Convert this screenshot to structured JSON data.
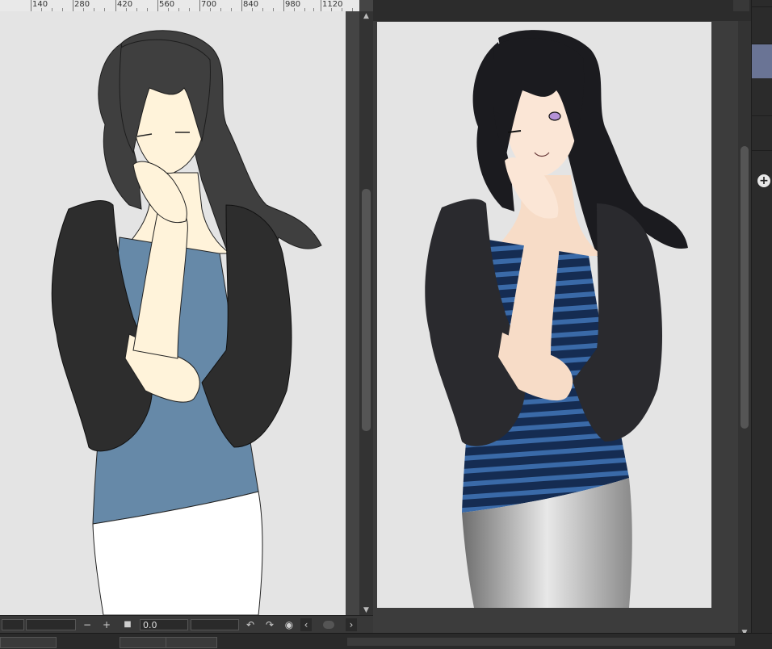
{
  "ruler": {
    "labels": [
      "140",
      "280",
      "420",
      "560",
      "700",
      "840",
      "980",
      "1120"
    ]
  },
  "left_canvas": {
    "angle_value": "0.0",
    "zoom_out_label": "−",
    "zoom_in_label": "+",
    "fit_label": "■",
    "prev_label": "‹",
    "next_label": "›"
  },
  "right_panel": {
    "add_label": "+"
  },
  "colors": {
    "hair": "#3f3f3f",
    "skin": "#fff3da",
    "top_flat": "#6689a8",
    "jacket": "#2d2d2d",
    "pants_flat": "#ffffff",
    "top_rendered": "#1f3d6b",
    "pants_rendered": "#9a9a9a",
    "accent": "#6a7495"
  },
  "icons": {
    "rotate_left": "rotate-left-icon",
    "rotate_right": "rotate-right-icon",
    "reset_rotation": "reset-rotation-icon",
    "flip": "flip-icon",
    "add": "add-icon"
  }
}
